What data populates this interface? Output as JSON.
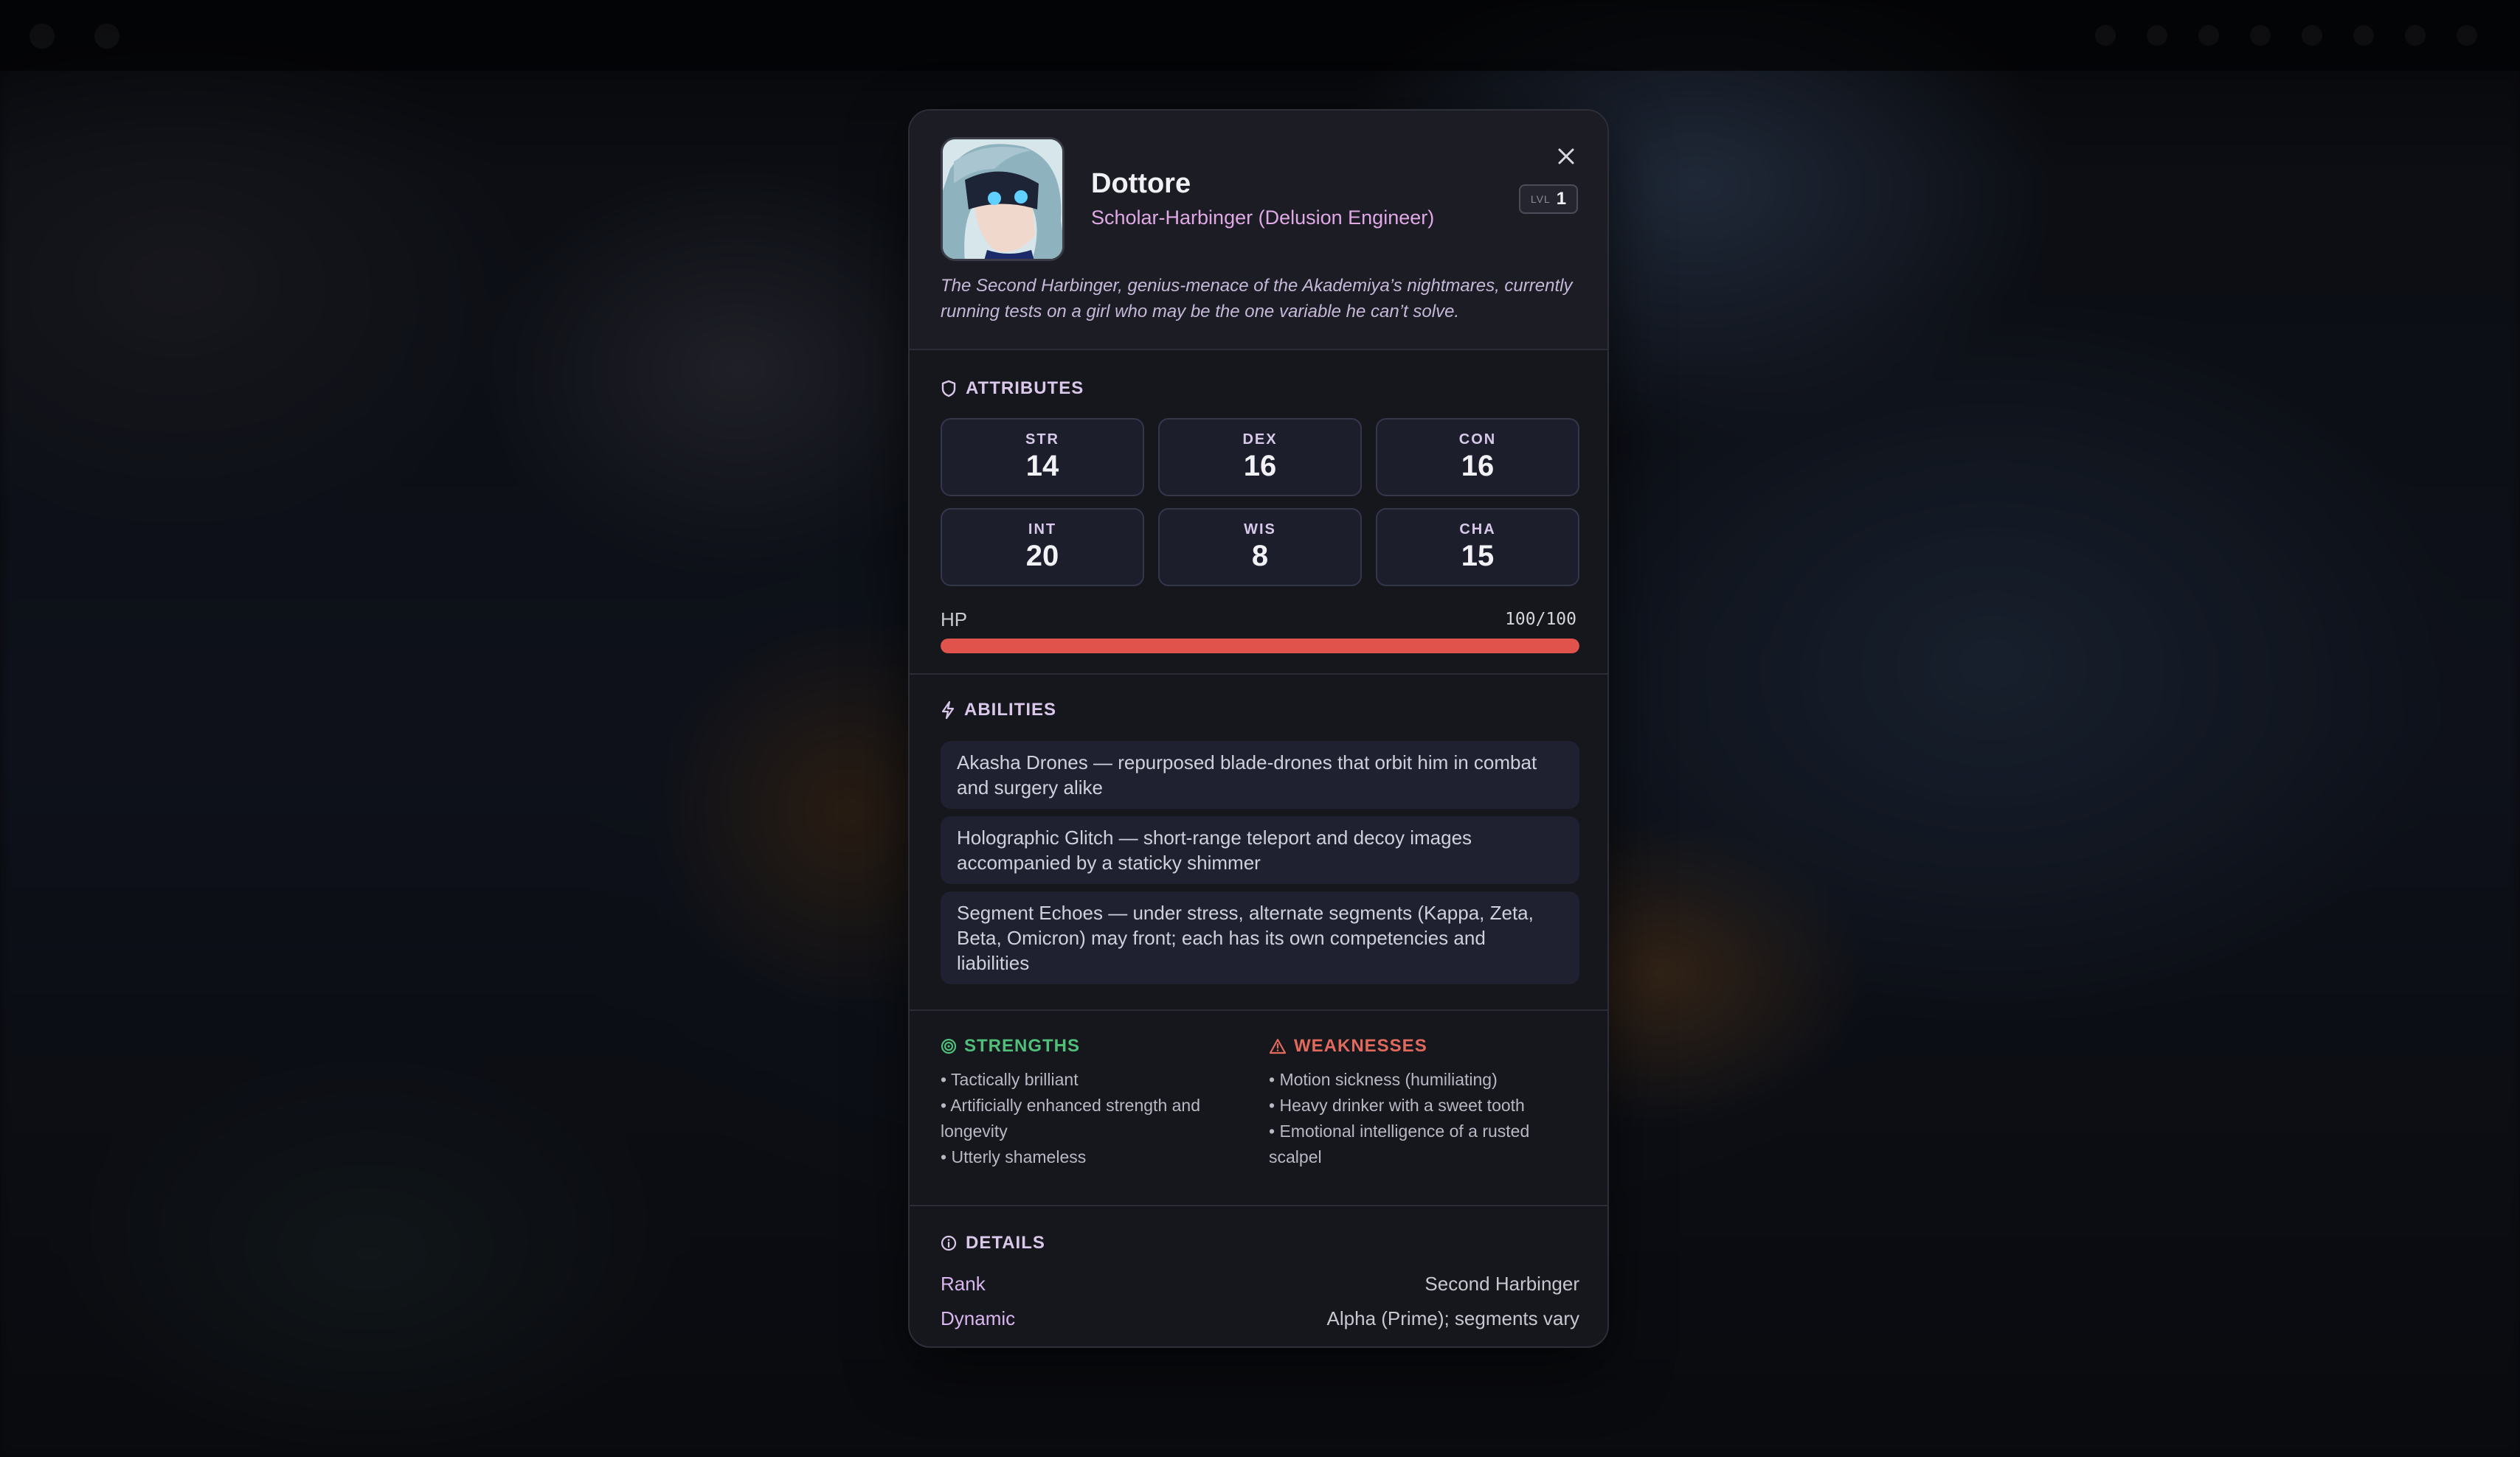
{
  "character": {
    "name": "Dottore",
    "class": "Scholar-Harbinger (Delusion Engineer)",
    "level_label": "LVL",
    "level": "1",
    "tagline": "The Second Harbinger, genius-menace of the Akademiya’s nightmares, currently running tests on a girl who may be the one variable he can’t solve."
  },
  "attributes": {
    "title": "ATTRIBUTES",
    "stats": [
      {
        "label": "STR",
        "value": "14"
      },
      {
        "label": "DEX",
        "value": "16"
      },
      {
        "label": "CON",
        "value": "16"
      },
      {
        "label": "INT",
        "value": "20"
      },
      {
        "label": "WIS",
        "value": "8"
      },
      {
        "label": "CHA",
        "value": "15"
      }
    ],
    "hp_label": "HP",
    "hp_value": "100/100",
    "hp_fraction": 1.0
  },
  "abilities": {
    "title": "ABILITIES",
    "items": [
      "Akasha Drones — repurposed blade-drones that orbit him in combat and surgery alike",
      "Holographic Glitch — short-range teleport and decoy images accompanied by a staticky shimmer",
      "Segment Echoes — under stress, alternate segments (Kappa, Zeta, Beta, Omicron) may front; each has its own competencies and liabilities"
    ]
  },
  "strengths": {
    "title": "STRENGTHS",
    "items": [
      "Tactically brilliant",
      "Artificially enhanced strength and longevity",
      "Utterly shameless"
    ]
  },
  "weaknesses": {
    "title": "WEAKNESSES",
    "items": [
      "Motion sickness (humiliating)",
      "Heavy drinker with a sweet tooth",
      "Emotional intelligence of a rusted scalpel"
    ]
  },
  "details": {
    "title": "DETAILS",
    "rows": [
      {
        "key": "Rank",
        "value": "Second Harbinger"
      },
      {
        "key": "Dynamic",
        "value": "Alpha (Prime); segments vary"
      }
    ]
  },
  "colors": {
    "accent": "#e0a9e6",
    "hp": "#e0524c",
    "strengths": "#4fbf7a",
    "weaknesses": "#e26a5c"
  }
}
